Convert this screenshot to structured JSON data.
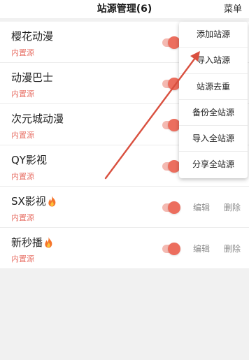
{
  "header": {
    "title": "站源管理(6)",
    "menu_label": "菜单"
  },
  "items": [
    {
      "name": "樱花动漫",
      "type": "内置源",
      "hot": false,
      "enabled": true
    },
    {
      "name": "动漫巴士",
      "type": "内置源",
      "hot": false,
      "enabled": true
    },
    {
      "name": "次元城动漫",
      "type": "内置源",
      "hot": false,
      "enabled": true
    },
    {
      "name": "QY影视",
      "type": "内置源",
      "hot": false,
      "enabled": true
    },
    {
      "name": "SX影视",
      "type": "内置源",
      "hot": true,
      "enabled": true,
      "edit_label": "编辑",
      "delete_label": "删除"
    },
    {
      "name": "新秒播",
      "type": "内置源",
      "hot": true,
      "enabled": true,
      "edit_label": "编辑",
      "delete_label": "删除"
    }
  ],
  "menu": {
    "items": [
      "添加站源",
      "导入站源",
      "站源去重",
      "备份全站源",
      "导入全站源",
      "分享全站源"
    ]
  },
  "colors": {
    "accent": "#ec6e5e",
    "accent_light": "#f4b9b1",
    "source_type": "#e8746a",
    "annotation_arrow": "#d9503f"
  }
}
